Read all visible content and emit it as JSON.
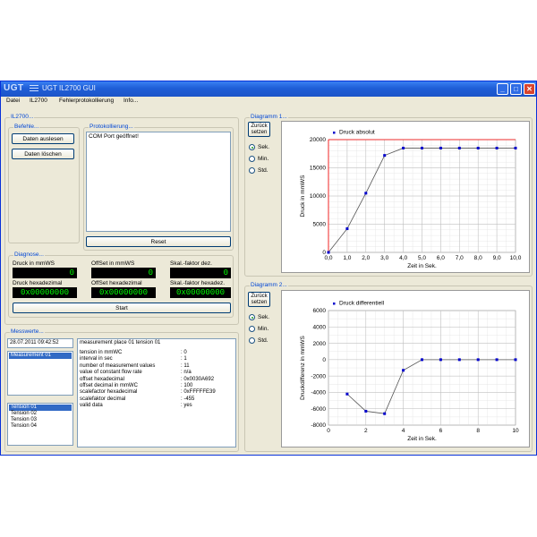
{
  "app": {
    "logo": "UGT",
    "title": "UGT IL2700 GUI"
  },
  "window_buttons": {
    "minimize": "_",
    "maximize": "□",
    "close": "✕"
  },
  "menu": [
    "Datei",
    "IL2700",
    "Fehlerprotokollierung",
    "Info..."
  ],
  "il2700_group": "IL2700...",
  "befehle": {
    "label": "Befehle...",
    "read_button": "Daten auslesen",
    "delete_button": "Daten löschen"
  },
  "protokoll": {
    "label": "Protokollierung...",
    "lines": [
      "COM Port geöffnet!"
    ],
    "reset_button": "Reset"
  },
  "diagnose": {
    "label": "Diagnose...",
    "druck_label": "Druck in mmWS",
    "druck_value": "0",
    "offset_label": "OffSet in mmWS",
    "offset_value": "0",
    "skal_label": "Skal.-faktor dez.",
    "skal_value": "0",
    "druck_hex_label": "Druck hexadezimal",
    "druck_hex_value": "0x00000000",
    "offset_hex_label": "OffSet hexadezimal",
    "offset_hex_value": "0x00000000",
    "skal_hex_label": "Skal.-faktor hexadez.",
    "skal_hex_value": "0x00000000",
    "start_button": "Start"
  },
  "messwerte": {
    "label": "Messwerte...",
    "timestamp": "28.07.2011 09:42:52",
    "measurements": [
      "Measurement 01"
    ],
    "tensions": [
      "Tension 01",
      "Tension 02",
      "Tension 03",
      "Tension 04"
    ],
    "header": "measurement place 01 tension 01",
    "details": [
      {
        "key": "tension in mmWC",
        "value": ": 0"
      },
      {
        "key": "interval in sec",
        "value": ": 1"
      },
      {
        "key": "number of measurement values",
        "value": ": 11"
      },
      {
        "key": "value of constant flow rate",
        "value": ": n/a"
      },
      {
        "key": "offset hexadecimal",
        "value": ": 0x0030A692"
      },
      {
        "key": "offset decimal in mmWC",
        "value": ": 100"
      },
      {
        "key": "scalefactor hexadecimal",
        "value": ": 0xFFFFFE39"
      },
      {
        "key": "scalefaktor decimal",
        "value": ": -455"
      },
      {
        "key": "valid data",
        "value": ": yes"
      }
    ]
  },
  "diagramm1": {
    "label": "Diagramm 1...",
    "back_button_line1": "Zurück",
    "back_button_line2": "setzen",
    "radios": [
      "Sek.",
      "Min.",
      "Std."
    ],
    "selected": "Sek."
  },
  "diagramm2": {
    "label": "Diagramm 2...",
    "back_button_line1": "Zurück",
    "back_button_line2": "setzen",
    "radios": [
      "Sek.",
      "Min.",
      "Std."
    ],
    "selected": "Sek."
  },
  "chart_data": [
    {
      "type": "line",
      "legend": "Druck absolut",
      "legend_position": "top-left",
      "xlabel": "Zeit in Sek.",
      "ylabel": "Druck in mmWS",
      "x": [
        0,
        1,
        2,
        3,
        4,
        5,
        6,
        7,
        8,
        9,
        10
      ],
      "y": [
        0,
        4200,
        10500,
        17200,
        18500,
        18500,
        18500,
        18500,
        18500,
        18500,
        18500
      ],
      "xlim": [
        0,
        10
      ],
      "ylim": [
        0,
        20000
      ],
      "xticks": [
        "0,0",
        "1,0",
        "2,0",
        "3,0",
        "4,0",
        "5,0",
        "6,0",
        "7,0",
        "8,0",
        "9,0",
        "10,0"
      ],
      "yticks": [
        "0",
        "5000",
        "10000",
        "15000",
        "20000"
      ],
      "grid": true,
      "series_color": "#0000cc",
      "line_color": "#555555",
      "limit_color": "#ff0000"
    },
    {
      "type": "line",
      "legend": "Druck differentiell",
      "legend_position": "top-left",
      "xlabel": "Zeit in Sek.",
      "ylabel": "Druckdifferenz in mmWS",
      "x": [
        1,
        2,
        3,
        4,
        5,
        6,
        7,
        8,
        9,
        10
      ],
      "y": [
        -4200,
        -6300,
        -6600,
        -1300,
        0,
        0,
        0,
        0,
        0,
        0
      ],
      "xlim": [
        0,
        10
      ],
      "ylim": [
        -8000,
        6000
      ],
      "xticks": [
        "0",
        "2",
        "4",
        "6",
        "8",
        "10"
      ],
      "yticks": [
        "-8000",
        "-6000",
        "-4000",
        "-2000",
        "0",
        "2000",
        "4000",
        "6000"
      ],
      "grid": true,
      "series_color": "#0000cc",
      "line_color": "#555555"
    }
  ]
}
